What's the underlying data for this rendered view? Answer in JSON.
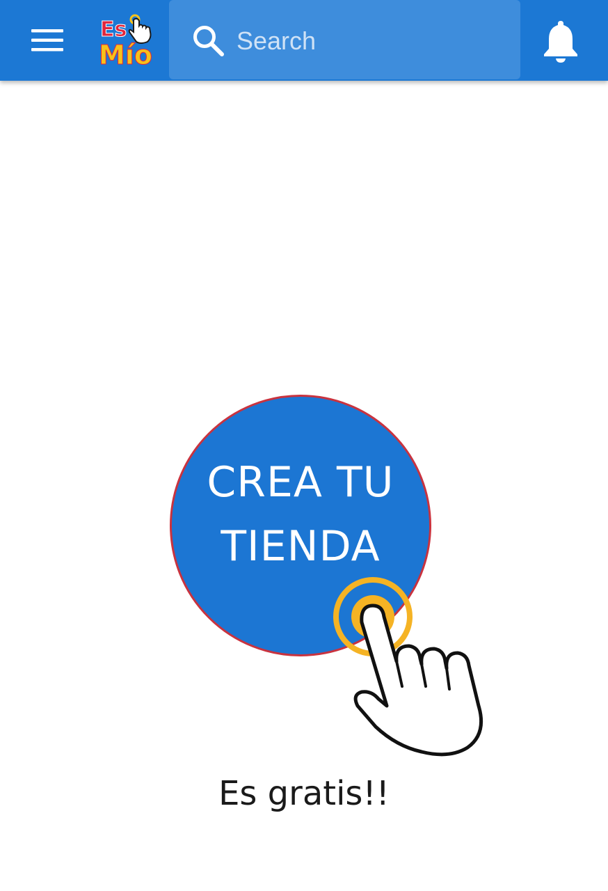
{
  "header": {
    "menu_icon": "hamburger-menu-icon",
    "logo": {
      "top_text": "Es",
      "bottom_text": "Mío"
    },
    "search": {
      "placeholder": "Search",
      "icon": "search-icon"
    },
    "notifications_icon": "bell-icon"
  },
  "cta": {
    "line1": "CREA TU",
    "line2": "TIENDA",
    "hand_icon": "pointing-hand-icon"
  },
  "footer": {
    "text": "Es gratis!!"
  },
  "colors": {
    "app_bar": "#1c78d4",
    "search_bg": "#3e8ddc",
    "cta_fill": "#1c76d3",
    "cta_border": "#c9333f",
    "tap_ring": "#f5b324",
    "logo_red": "#e0263c",
    "logo_yellow": "#f7c21a"
  }
}
